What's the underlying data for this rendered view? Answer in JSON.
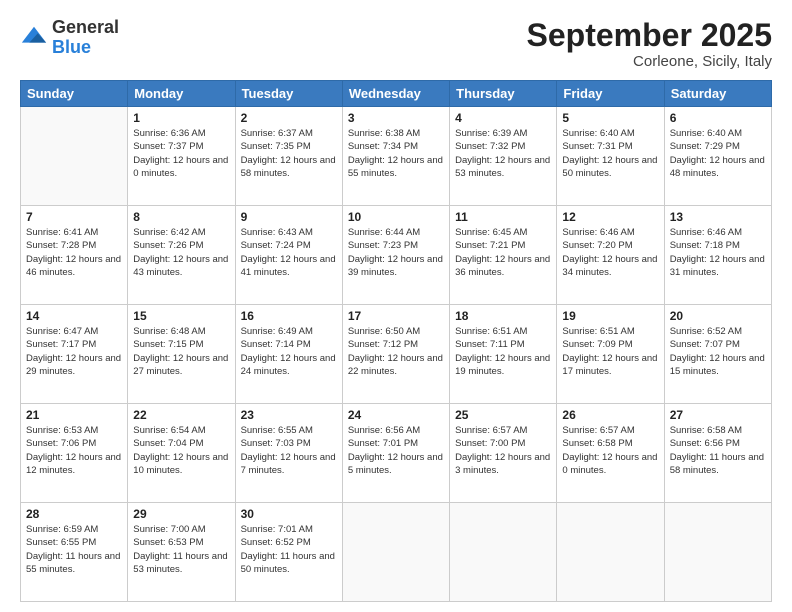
{
  "logo": {
    "general": "General",
    "blue": "Blue"
  },
  "header": {
    "month": "September 2025",
    "location": "Corleone, Sicily, Italy"
  },
  "weekdays": [
    "Sunday",
    "Monday",
    "Tuesday",
    "Wednesday",
    "Thursday",
    "Friday",
    "Saturday"
  ],
  "weeks": [
    [
      {
        "day": "",
        "sunrise": "",
        "sunset": "",
        "daylight": ""
      },
      {
        "day": "1",
        "sunrise": "Sunrise: 6:36 AM",
        "sunset": "Sunset: 7:37 PM",
        "daylight": "Daylight: 12 hours and 0 minutes."
      },
      {
        "day": "2",
        "sunrise": "Sunrise: 6:37 AM",
        "sunset": "Sunset: 7:35 PM",
        "daylight": "Daylight: 12 hours and 58 minutes."
      },
      {
        "day": "3",
        "sunrise": "Sunrise: 6:38 AM",
        "sunset": "Sunset: 7:34 PM",
        "daylight": "Daylight: 12 hours and 55 minutes."
      },
      {
        "day": "4",
        "sunrise": "Sunrise: 6:39 AM",
        "sunset": "Sunset: 7:32 PM",
        "daylight": "Daylight: 12 hours and 53 minutes."
      },
      {
        "day": "5",
        "sunrise": "Sunrise: 6:40 AM",
        "sunset": "Sunset: 7:31 PM",
        "daylight": "Daylight: 12 hours and 50 minutes."
      },
      {
        "day": "6",
        "sunrise": "Sunrise: 6:40 AM",
        "sunset": "Sunset: 7:29 PM",
        "daylight": "Daylight: 12 hours and 48 minutes."
      }
    ],
    [
      {
        "day": "7",
        "sunrise": "Sunrise: 6:41 AM",
        "sunset": "Sunset: 7:28 PM",
        "daylight": "Daylight: 12 hours and 46 minutes."
      },
      {
        "day": "8",
        "sunrise": "Sunrise: 6:42 AM",
        "sunset": "Sunset: 7:26 PM",
        "daylight": "Daylight: 12 hours and 43 minutes."
      },
      {
        "day": "9",
        "sunrise": "Sunrise: 6:43 AM",
        "sunset": "Sunset: 7:24 PM",
        "daylight": "Daylight: 12 hours and 41 minutes."
      },
      {
        "day": "10",
        "sunrise": "Sunrise: 6:44 AM",
        "sunset": "Sunset: 7:23 PM",
        "daylight": "Daylight: 12 hours and 39 minutes."
      },
      {
        "day": "11",
        "sunrise": "Sunrise: 6:45 AM",
        "sunset": "Sunset: 7:21 PM",
        "daylight": "Daylight: 12 hours and 36 minutes."
      },
      {
        "day": "12",
        "sunrise": "Sunrise: 6:46 AM",
        "sunset": "Sunset: 7:20 PM",
        "daylight": "Daylight: 12 hours and 34 minutes."
      },
      {
        "day": "13",
        "sunrise": "Sunrise: 6:46 AM",
        "sunset": "Sunset: 7:18 PM",
        "daylight": "Daylight: 12 hours and 31 minutes."
      }
    ],
    [
      {
        "day": "14",
        "sunrise": "Sunrise: 6:47 AM",
        "sunset": "Sunset: 7:17 PM",
        "daylight": "Daylight: 12 hours and 29 minutes."
      },
      {
        "day": "15",
        "sunrise": "Sunrise: 6:48 AM",
        "sunset": "Sunset: 7:15 PM",
        "daylight": "Daylight: 12 hours and 27 minutes."
      },
      {
        "day": "16",
        "sunrise": "Sunrise: 6:49 AM",
        "sunset": "Sunset: 7:14 PM",
        "daylight": "Daylight: 12 hours and 24 minutes."
      },
      {
        "day": "17",
        "sunrise": "Sunrise: 6:50 AM",
        "sunset": "Sunset: 7:12 PM",
        "daylight": "Daylight: 12 hours and 22 minutes."
      },
      {
        "day": "18",
        "sunrise": "Sunrise: 6:51 AM",
        "sunset": "Sunset: 7:11 PM",
        "daylight": "Daylight: 12 hours and 19 minutes."
      },
      {
        "day": "19",
        "sunrise": "Sunrise: 6:51 AM",
        "sunset": "Sunset: 7:09 PM",
        "daylight": "Daylight: 12 hours and 17 minutes."
      },
      {
        "day": "20",
        "sunrise": "Sunrise: 6:52 AM",
        "sunset": "Sunset: 7:07 PM",
        "daylight": "Daylight: 12 hours and 15 minutes."
      }
    ],
    [
      {
        "day": "21",
        "sunrise": "Sunrise: 6:53 AM",
        "sunset": "Sunset: 7:06 PM",
        "daylight": "Daylight: 12 hours and 12 minutes."
      },
      {
        "day": "22",
        "sunrise": "Sunrise: 6:54 AM",
        "sunset": "Sunset: 7:04 PM",
        "daylight": "Daylight: 12 hours and 10 minutes."
      },
      {
        "day": "23",
        "sunrise": "Sunrise: 6:55 AM",
        "sunset": "Sunset: 7:03 PM",
        "daylight": "Daylight: 12 hours and 7 minutes."
      },
      {
        "day": "24",
        "sunrise": "Sunrise: 6:56 AM",
        "sunset": "Sunset: 7:01 PM",
        "daylight": "Daylight: 12 hours and 5 minutes."
      },
      {
        "day": "25",
        "sunrise": "Sunrise: 6:57 AM",
        "sunset": "Sunset: 7:00 PM",
        "daylight": "Daylight: 12 hours and 3 minutes."
      },
      {
        "day": "26",
        "sunrise": "Sunrise: 6:57 AM",
        "sunset": "Sunset: 6:58 PM",
        "daylight": "Daylight: 12 hours and 0 minutes."
      },
      {
        "day": "27",
        "sunrise": "Sunrise: 6:58 AM",
        "sunset": "Sunset: 6:56 PM",
        "daylight": "Daylight: 11 hours and 58 minutes."
      }
    ],
    [
      {
        "day": "28",
        "sunrise": "Sunrise: 6:59 AM",
        "sunset": "Sunset: 6:55 PM",
        "daylight": "Daylight: 11 hours and 55 minutes."
      },
      {
        "day": "29",
        "sunrise": "Sunrise: 7:00 AM",
        "sunset": "Sunset: 6:53 PM",
        "daylight": "Daylight: 11 hours and 53 minutes."
      },
      {
        "day": "30",
        "sunrise": "Sunrise: 7:01 AM",
        "sunset": "Sunset: 6:52 PM",
        "daylight": "Daylight: 11 hours and 50 minutes."
      },
      {
        "day": "",
        "sunrise": "",
        "sunset": "",
        "daylight": ""
      },
      {
        "day": "",
        "sunrise": "",
        "sunset": "",
        "daylight": ""
      },
      {
        "day": "",
        "sunrise": "",
        "sunset": "",
        "daylight": ""
      },
      {
        "day": "",
        "sunrise": "",
        "sunset": "",
        "daylight": ""
      }
    ]
  ]
}
